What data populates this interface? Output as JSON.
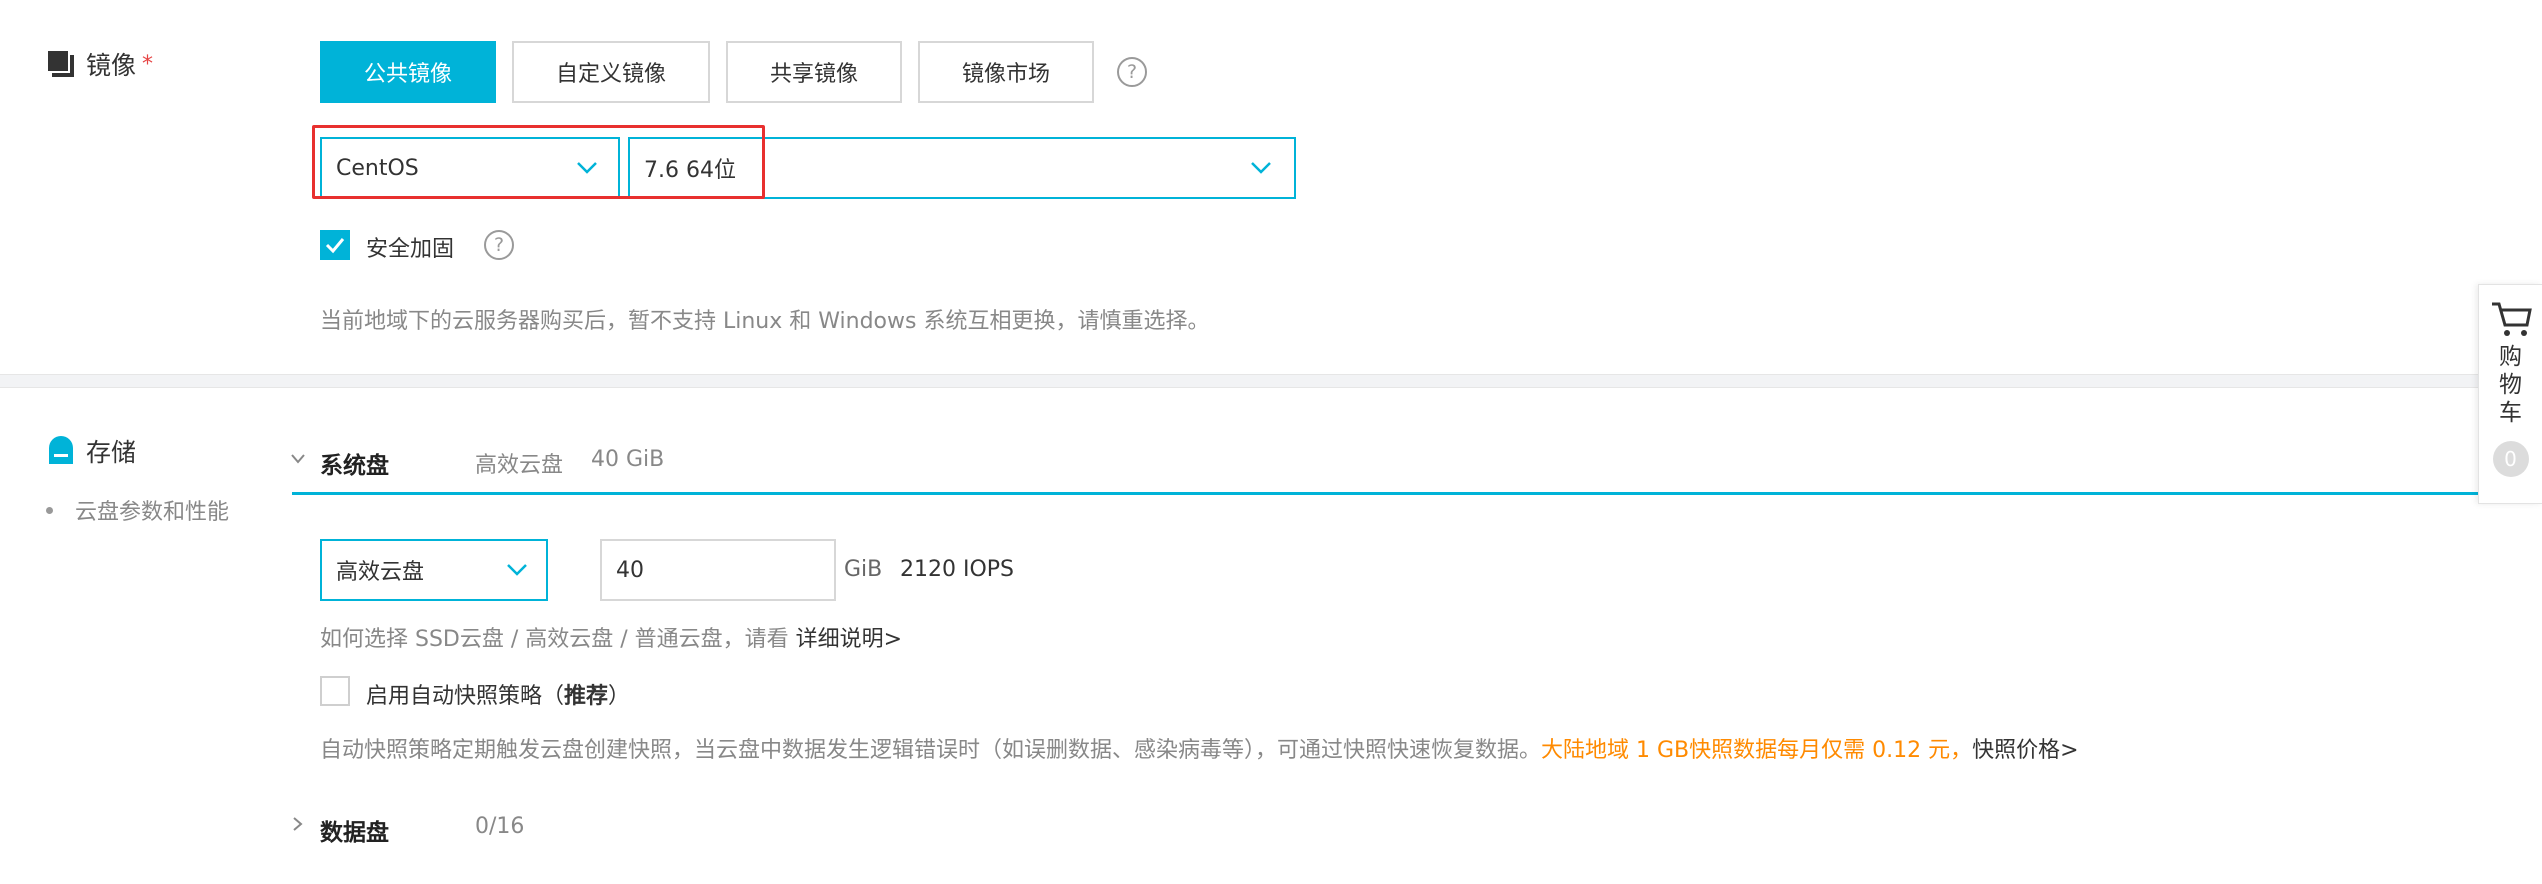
{
  "image_section": {
    "title": "镜像",
    "required_mark": "*",
    "tabs": [
      {
        "label": "公共镜像",
        "active": true
      },
      {
        "label": "自定义镜像",
        "active": false
      },
      {
        "label": "共享镜像",
        "active": false
      },
      {
        "label": "镜像市场",
        "active": false
      }
    ],
    "help": "?",
    "os_select": {
      "value": "CentOS"
    },
    "version_select": {
      "value": "7.6 64位"
    },
    "security_checkbox": {
      "label": "安全加固",
      "checked": true
    },
    "note": "当前地域下的云服务器购买后，暂不支持 Linux 和 Windows 系统互相更换，请慎重选择。"
  },
  "storage_section": {
    "title": "存储",
    "side_link": "云盘参数和性能",
    "system_disk": {
      "label": "系统盘",
      "summary_type": "高效云盘",
      "summary_size": "40 GiB",
      "type_select": "高效云盘",
      "size_value": "40",
      "unit": "GiB",
      "iops": "2120 IOPS",
      "help_text": "如何选择 SSD云盘 / 高效云盘 / 普通云盘，请看",
      "help_link": "详细说明>"
    },
    "snapshot": {
      "label_prefix": "启用自动快照策略（",
      "label_bold": "推荐",
      "label_suffix": "）",
      "checked": false,
      "desc": "自动快照策略定期触发云盘创建快照，当云盘中数据发生逻辑错误时（如误删数据、感染病毒等），可通过快照快速恢复数据。",
      "promo": "大陆地域 1 GB快照数据每月仅需 0.12 元，",
      "price_link": "快照价格>"
    },
    "data_disk": {
      "label": "数据盘",
      "count": "0/16"
    }
  },
  "cart": {
    "label": "购物车",
    "count": "0"
  },
  "colors": {
    "accent": "#00b3d8",
    "highlight_border": "#e8302f",
    "promo": "#ff8a00"
  }
}
